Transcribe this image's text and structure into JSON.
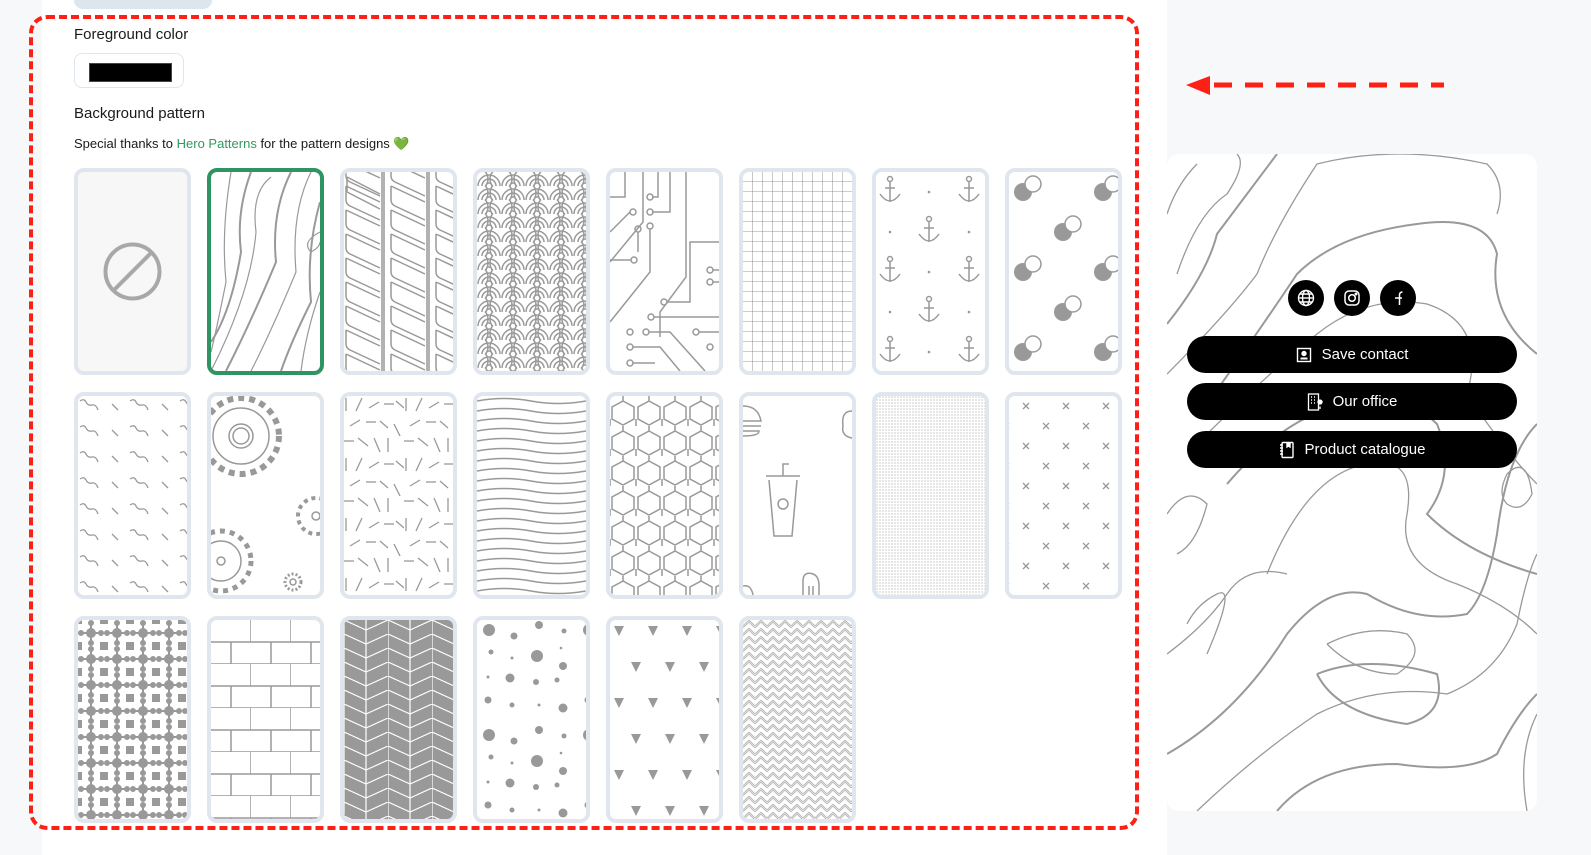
{
  "foreground": {
    "label": "Foreground color",
    "value": "#000000"
  },
  "background_pattern": {
    "label": "Background pattern",
    "thanks_prefix": "Special thanks to ",
    "thanks_link": "Hero Patterns",
    "thanks_suffix": " for the pattern designs ",
    "heart": "💚",
    "selected_index": 1,
    "patterns": [
      {
        "name": "none"
      },
      {
        "name": "topography"
      },
      {
        "name": "leaf"
      },
      {
        "name": "japanese-waves"
      },
      {
        "name": "circuit-board"
      },
      {
        "name": "graph-paper"
      },
      {
        "name": "anchors"
      },
      {
        "name": "bubbles"
      },
      {
        "name": "squiggles"
      },
      {
        "name": "gears"
      },
      {
        "name": "scattered-lines"
      },
      {
        "name": "wavy-lines"
      },
      {
        "name": "hexagons"
      },
      {
        "name": "food"
      },
      {
        "name": "tiny-dots"
      },
      {
        "name": "crosses"
      },
      {
        "name": "molecules"
      },
      {
        "name": "bricks"
      },
      {
        "name": "herringbone"
      },
      {
        "name": "polka-dots"
      },
      {
        "name": "triangles"
      },
      {
        "name": "zigzag"
      }
    ]
  },
  "preview": {
    "socials": [
      {
        "icon": "globe-icon"
      },
      {
        "icon": "instagram-icon"
      },
      {
        "icon": "facebook-icon"
      }
    ],
    "buttons": [
      {
        "label": "Save contact",
        "icon": "contact-card-icon"
      },
      {
        "label": "Our office",
        "icon": "office-building-icon"
      },
      {
        "label": "Product catalogue",
        "icon": "notebook-icon"
      }
    ]
  },
  "colors": {
    "accent_green": "#2f9462",
    "annotation_red": "#ff2015"
  }
}
